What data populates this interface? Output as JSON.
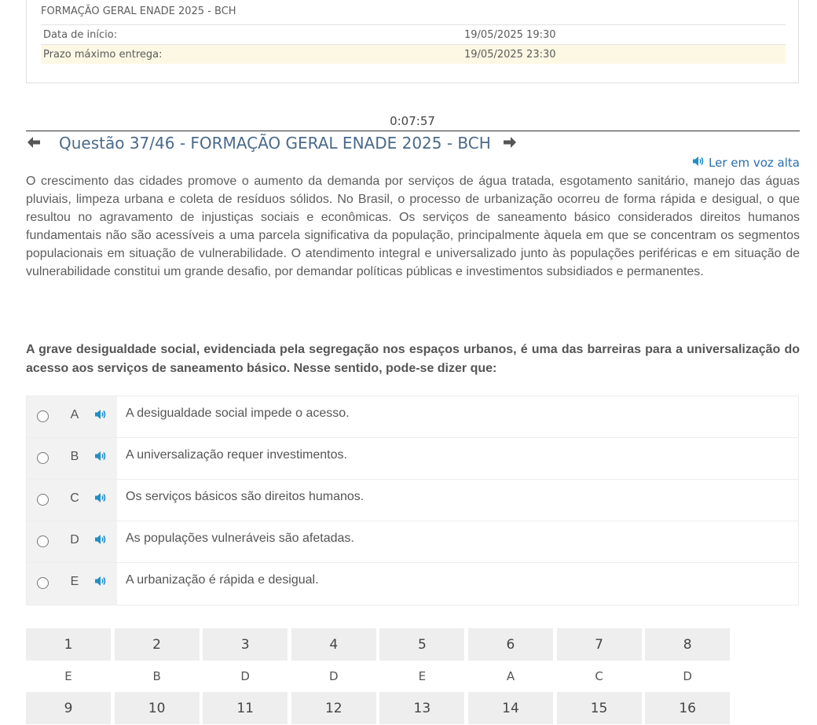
{
  "info": {
    "title": "FORMAÇÃO GERAL ENADE 2025 - BCH",
    "rows": [
      {
        "label": "Data de início:",
        "value": "19/05/2025 19:30"
      },
      {
        "label": "Prazo máximo entrega:",
        "value": "19/05/2025 23:30"
      }
    ]
  },
  "timer": "0:07:57",
  "question": {
    "title": "Questão 37/46 - FORMAÇÃO GERAL ENADE 2025 - BCH",
    "read_aloud": "Ler em voz alta",
    "passage": "O crescimento das cidades promove o aumento da demanda por serviços de água tratada, esgotamento sanitário, manejo das águas pluviais, limpeza urbana e coleta de resíduos sólidos. No Brasil, o processo de urbanização ocorreu de forma rápida e desigual, o que resultou no agravamento de injustiças sociais e econômicas. Os serviços de saneamento básico considerados direitos humanos fundamentais não são acessíveis a uma parcela significativa da população, principalmente àquela em que se concentram os segmentos populacionais em situação de vulnerabilidade. O atendimento integral e universalizado junto às populações periféricas e em situação de vulnerabilidade constitui um grande desafio, por demandar políticas públicas e investimentos subsidiados e permanentes.",
    "prompt": "A grave desigualdade social, evidenciada pela segregação nos espaços urbanos, é uma das barreiras para a universalização do acesso aos serviços de saneamento básico. Nesse sentido, pode-se dizer que:",
    "options": [
      {
        "letter": "A",
        "text": "A desigualdade social impede o acesso."
      },
      {
        "letter": "B",
        "text": "A universalização requer investimentos."
      },
      {
        "letter": "C",
        "text": "Os serviços básicos são direitos humanos."
      },
      {
        "letter": "D",
        "text": "As populações vulneráveis são afetadas."
      },
      {
        "letter": "E",
        "text": "A urbanização é rápida e desigual."
      }
    ]
  },
  "navigation": {
    "row1": [
      {
        "num": "1",
        "answer": "E"
      },
      {
        "num": "2",
        "answer": "B"
      },
      {
        "num": "3",
        "answer": "D"
      },
      {
        "num": "4",
        "answer": "D"
      },
      {
        "num": "5",
        "answer": "E"
      },
      {
        "num": "6",
        "answer": "A"
      },
      {
        "num": "7",
        "answer": "C"
      },
      {
        "num": "8",
        "answer": "D"
      }
    ],
    "row2": [
      {
        "num": "9"
      },
      {
        "num": "10"
      },
      {
        "num": "11"
      },
      {
        "num": "12"
      },
      {
        "num": "13"
      },
      {
        "num": "14"
      },
      {
        "num": "15"
      },
      {
        "num": "16"
      }
    ]
  },
  "icons": {
    "prev": "arrow-left-icon",
    "next": "arrow-right-icon",
    "speaker": "speaker-icon"
  },
  "colors": {
    "title": "#4a6a8a",
    "link": "#2b6ea8",
    "speaker": "#1f8fc6",
    "highlight_row": "#fcf8e3"
  }
}
